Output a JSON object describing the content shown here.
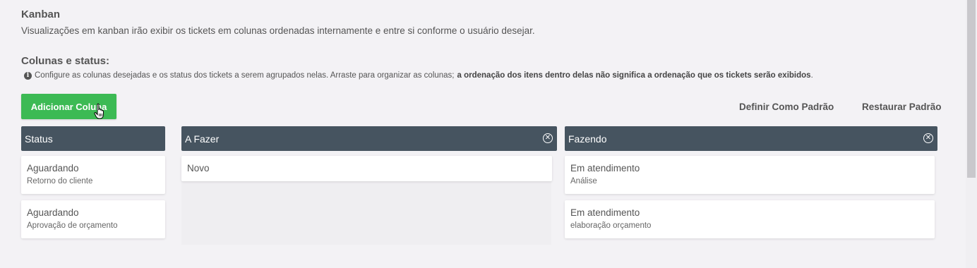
{
  "kanban": {
    "title": "Kanban",
    "description": "Visualizações em kanban irão exibir os tickets em colunas ordenadas internamente e entre si conforme o usuário desejar."
  },
  "columns_section": {
    "title": "Colunas e status:",
    "hint_normal": "Configure as colunas desejadas e os status dos tickets a serem agrupados nelas. Arraste para organizar as colunas;",
    "hint_bold": "a ordenação dos itens dentro delas não significa a ordenação que os tickets serão exibidos",
    "hint_end": "."
  },
  "actions": {
    "add_column": "Adicionar Coluna",
    "set_default": "Definir Como Padrão",
    "restore_default": "Restaurar Padrão"
  },
  "columns": [
    {
      "name": "Status",
      "closable": false,
      "cards": [
        {
          "title": "Aguardando",
          "sub": "Retorno do cliente"
        },
        {
          "title": "Aguardando",
          "sub": "Aprovação de orçamento"
        }
      ]
    },
    {
      "name": "A Fazer",
      "closable": true,
      "cards": [
        {
          "title": "Novo",
          "sub": ""
        }
      ]
    },
    {
      "name": "Fazendo",
      "closable": true,
      "cards": [
        {
          "title": "Em atendimento",
          "sub": "Análise"
        },
        {
          "title": "Em atendimento",
          "sub": "elaboração orçamento"
        }
      ]
    }
  ],
  "colors": {
    "accent": "#3cba54",
    "column_header": "#465460"
  }
}
